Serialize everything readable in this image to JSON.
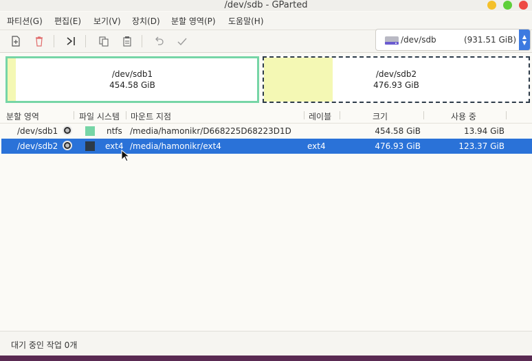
{
  "window": {
    "title": "/dev/sdb - GParted"
  },
  "menu": {
    "items": [
      "파티션(G)",
      "편집(E)",
      "보기(V)",
      "장치(D)",
      "분할 영역(P)",
      "도움말(H)"
    ]
  },
  "toolbar": {
    "buttons": [
      "new-icon",
      "delete-icon",
      "resize-icon",
      "copy-icon",
      "paste-icon",
      "undo-icon",
      "apply-icon"
    ]
  },
  "device": {
    "name": "/dev/sdb",
    "size": "(931.51 GiB)"
  },
  "map": {
    "partitions": [
      {
        "name": "/dev/sdb1",
        "size": "454.58 GiB",
        "border_color": "#76d5a6"
      },
      {
        "name": "/dev/sdb2",
        "size": "476.93 GiB",
        "border_color": "#2c3a48"
      }
    ]
  },
  "table": {
    "headers": [
      "분할 영역",
      "파일 시스템",
      "마운트 지점",
      "레이블",
      "크기",
      "사용 중"
    ],
    "rows": [
      {
        "partition": "/dev/sdb1",
        "fs": "ntfs",
        "fs_color": "#76d5a6",
        "mount": "/media/hamonikr/D668225D68223D1D",
        "label": "",
        "size": "454.58 GiB",
        "used": "13.94 GiB",
        "selected": false
      },
      {
        "partition": "/dev/sdb2",
        "fs": "ext4",
        "fs_color": "#2c3a48",
        "mount": "/media/hamonikr/ext4",
        "label": "ext4",
        "size": "476.93 GiB",
        "used": "123.37 GiB",
        "selected": true
      }
    ]
  },
  "status": {
    "text": "대기 중인 작업 0개"
  },
  "colors": {
    "accent": "#2a72d8",
    "used_space": "#f4f8b4"
  }
}
